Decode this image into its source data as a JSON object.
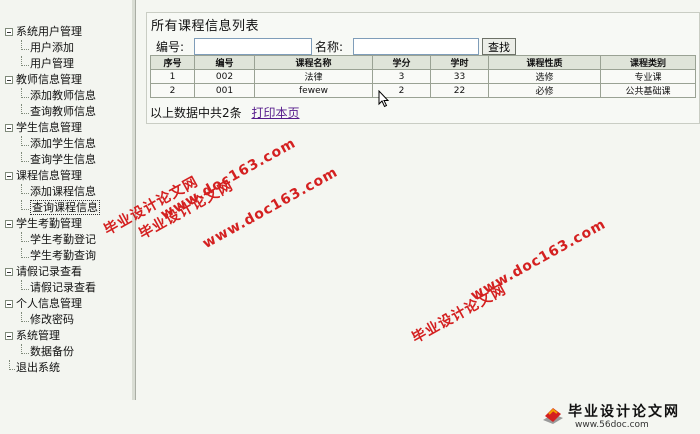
{
  "sidebar": {
    "items": [
      {
        "type": "root",
        "label": "系统用户管理"
      },
      {
        "type": "leaf",
        "label": "用户添加"
      },
      {
        "type": "leaf",
        "label": "用户管理"
      },
      {
        "type": "root",
        "label": "教师信息管理"
      },
      {
        "type": "leaf",
        "label": "添加教师信息"
      },
      {
        "type": "leaf",
        "label": "查询教师信息"
      },
      {
        "type": "root",
        "label": "学生信息管理"
      },
      {
        "type": "leaf",
        "label": "添加学生信息"
      },
      {
        "type": "leaf",
        "label": "查询学生信息"
      },
      {
        "type": "root",
        "label": "课程信息管理"
      },
      {
        "type": "leaf",
        "label": "添加课程信息"
      },
      {
        "type": "leaf",
        "label": "查询课程信息",
        "selected": true
      },
      {
        "type": "root",
        "label": "学生考勤管理"
      },
      {
        "type": "leaf",
        "label": "学生考勤登记"
      },
      {
        "type": "leaf",
        "label": "学生考勤查询"
      },
      {
        "type": "root",
        "label": "请假记录查看"
      },
      {
        "type": "leaf",
        "label": "请假记录查看"
      },
      {
        "type": "root",
        "label": "个人信息管理"
      },
      {
        "type": "leaf",
        "label": "修改密码"
      },
      {
        "type": "root",
        "label": "系统管理"
      },
      {
        "type": "leaf",
        "label": "数据备份"
      },
      {
        "type": "exit",
        "label": "退出系统"
      }
    ]
  },
  "main": {
    "title": "所有课程信息列表",
    "search": {
      "number_label": "编号:",
      "number_value": "",
      "name_label": "名称:",
      "name_value": "",
      "button_label": "查找"
    },
    "table": {
      "headers": [
        "序号",
        "编号",
        "课程名称",
        "学分",
        "学时",
        "课程性质",
        "课程类别"
      ],
      "rows": [
        [
          "1",
          "002",
          "法律",
          "3",
          "33",
          "选修",
          "专业课"
        ],
        [
          "2",
          "001",
          "fewew",
          "2",
          "22",
          "必修",
          "公共基础课"
        ]
      ]
    },
    "summary_text": "以上数据中共2条",
    "print_link": "打印本页"
  },
  "watermark": {
    "site_name": "毕业设计论文网",
    "url": "www.doc163.com"
  },
  "footer_logo": {
    "brand": "毕业设计论文网",
    "url": "www.56doc.com"
  },
  "colors": {
    "watermark": "#d42020",
    "header_bg": "#dfe4d9",
    "link": "#551a8b"
  }
}
